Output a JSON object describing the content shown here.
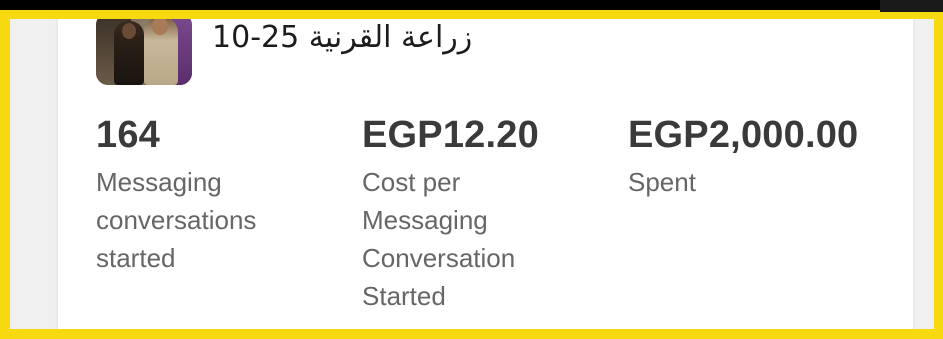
{
  "campaign": {
    "title": "زراعة القرنية 25-10",
    "thumbnail_icon": "campaign-photo"
  },
  "metrics": [
    {
      "value": "164",
      "label": "Messaging conversations started"
    },
    {
      "value": "EGP12.20",
      "label": "Cost per Messaging Conversation Started"
    },
    {
      "value": "EGP2,000.00",
      "label": "Spent"
    }
  ],
  "colors": {
    "frame_border": "#f7d90f",
    "card_background": "#ffffff",
    "value_text": "#3a3a3a",
    "label_text": "#666666"
  }
}
